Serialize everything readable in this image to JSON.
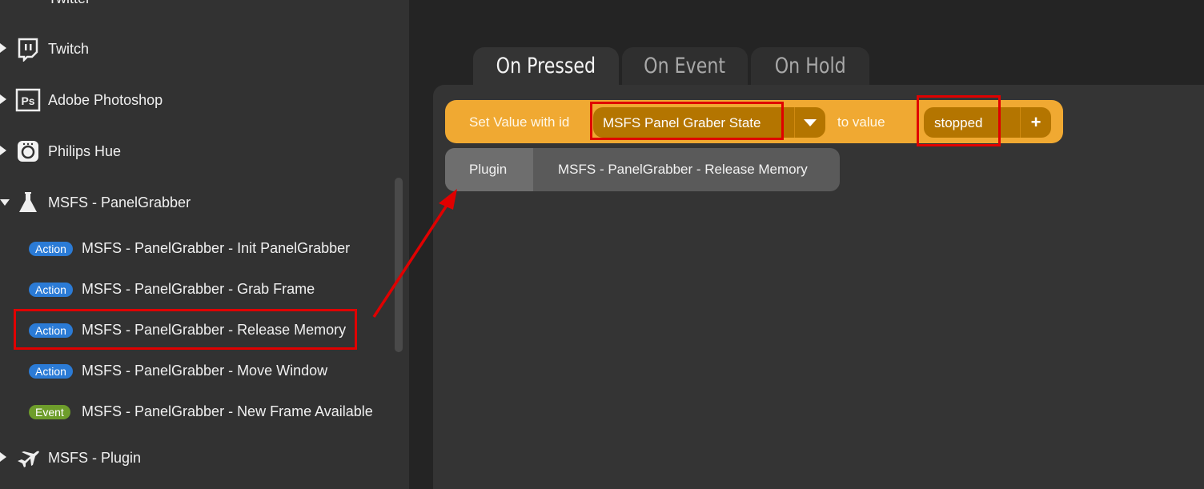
{
  "sidebar": {
    "partial_top_label": "Twitter",
    "groups": [
      {
        "label": "Twitch",
        "icon": "twitch-icon",
        "expanded": false
      },
      {
        "label": "Adobe Photoshop",
        "icon": "photoshop-icon",
        "expanded": false
      },
      {
        "label": "Philips Hue",
        "icon": "hue-bridge-icon",
        "expanded": false
      },
      {
        "label": "MSFS - PanelGrabber",
        "icon": "flask-icon",
        "expanded": true
      },
      {
        "label": "MSFS - Plugin",
        "icon": "airplane-icon",
        "expanded": false
      }
    ],
    "items": [
      {
        "type": "Action",
        "label": "MSFS - PanelGrabber - Init PanelGrabber"
      },
      {
        "type": "Action",
        "label": "MSFS - PanelGrabber - Grab Frame"
      },
      {
        "type": "Action",
        "label": "MSFS - PanelGrabber - Release Memory"
      },
      {
        "type": "Action",
        "label": "MSFS - PanelGrabber - Move Window"
      },
      {
        "type": "Event",
        "label": "MSFS - PanelGrabber - New Frame Available"
      }
    ]
  },
  "tabs": [
    {
      "label": "On Pressed",
      "active": true
    },
    {
      "label": "On Event",
      "active": false
    },
    {
      "label": "On Hold",
      "active": false
    }
  ],
  "set_block": {
    "prefix": "Set Value with id",
    "variable": "MSFS Panel Graber State",
    "middle": "to value",
    "value": "stopped",
    "add": "+"
  },
  "plugin_block": {
    "tag": "Plugin",
    "action": "MSFS - PanelGrabber - Release Memory"
  },
  "colors": {
    "block_orange": "#f0a932",
    "dropdown_dark_orange": "#b47500",
    "action_badge": "#2b7bd6",
    "event_badge": "#6e9d2b",
    "highlight_red": "#e00000"
  }
}
